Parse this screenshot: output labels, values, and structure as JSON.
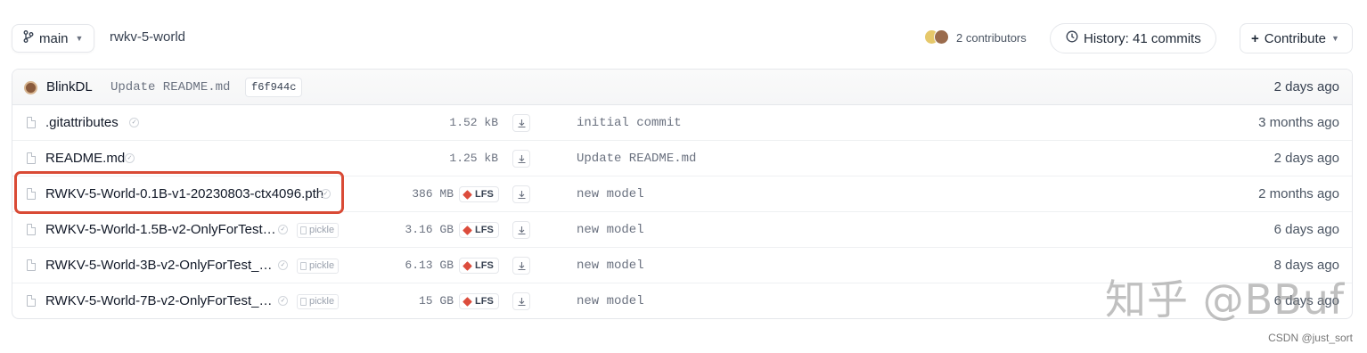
{
  "header": {
    "branch_label": "main",
    "repo_path": "rwkv-5-world",
    "contributors_text": "2 contributors",
    "history_label": "History: 41 commits",
    "contribute_label": "Contribute",
    "contribute_prefix": "+"
  },
  "last_commit": {
    "author": "BlinkDL",
    "message": "Update README.md",
    "hash": "f6f944c",
    "time": "2 days ago"
  },
  "files": [
    {
      "name": ".gitattributes",
      "size": "1.52 kB",
      "lfs": "",
      "pickle": "",
      "commit": "initial commit",
      "time": "3 months ago"
    },
    {
      "name": "README.md",
      "size": "1.25 kB",
      "lfs": "",
      "pickle": "",
      "commit": "Update README.md",
      "time": "2 days ago"
    },
    {
      "name": "RWKV-5-World-0.1B-v1-20230803-ctx4096.pth",
      "size": "386 MB",
      "lfs": "LFS",
      "pickle": "",
      "commit": "new model",
      "time": "2 months ago"
    },
    {
      "name": "RWKV-5-World-1.5B-v2-OnlyForTest…",
      "size": "3.16 GB",
      "lfs": "LFS",
      "pickle": "pickle",
      "commit": "new model",
      "time": "6 days ago"
    },
    {
      "name": "RWKV-5-World-3B-v2-OnlyForTest_…",
      "size": "6.13 GB",
      "lfs": "LFS",
      "pickle": "pickle",
      "commit": "new model",
      "time": "8 days ago"
    },
    {
      "name": "RWKV-5-World-7B-v2-OnlyForTest_…",
      "size": "15 GB",
      "lfs": "LFS",
      "pickle": "pickle",
      "commit": "new model",
      "time": "6 days ago"
    }
  ],
  "watermarks": {
    "zhihu": "知乎 @BBuf",
    "csdn": "CSDN @just_sort"
  },
  "colors": {
    "highlight": "#d94a35",
    "lfs_gem": "#dc4c3c",
    "border": "#e5e7eb"
  },
  "icons": [
    "branch-icon",
    "clock-icon",
    "file-icon",
    "download-icon",
    "lfs-gem-icon",
    "pickle-icon",
    "safe-check-icon"
  ]
}
